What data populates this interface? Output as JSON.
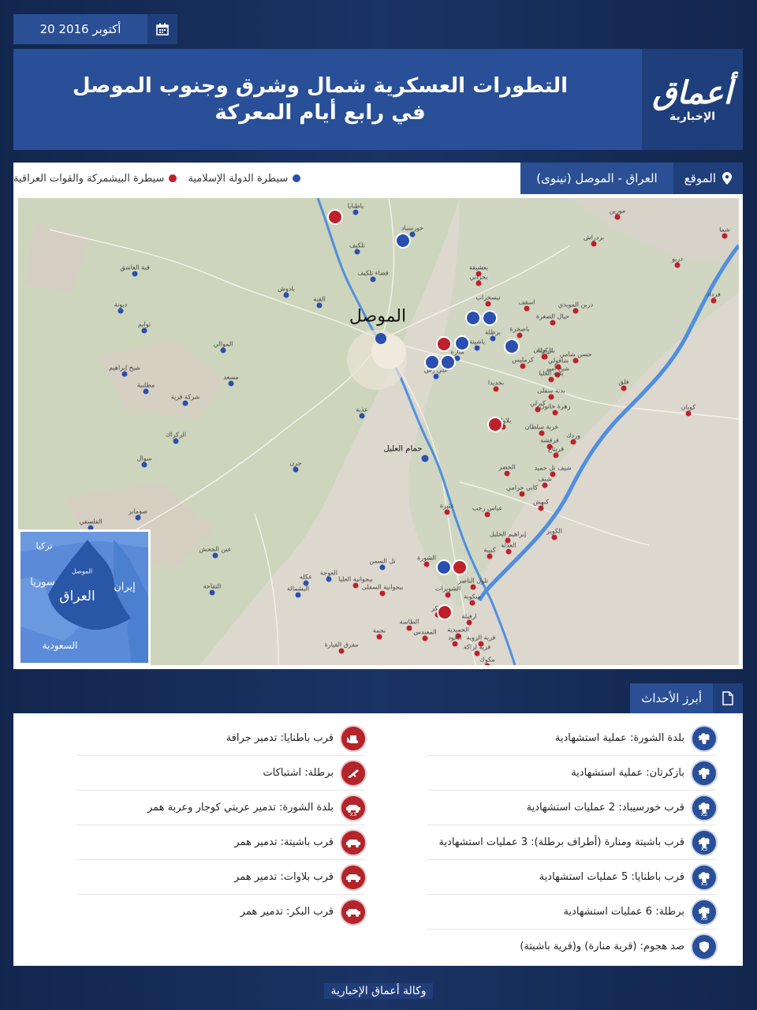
{
  "date": {
    "text": "20 أكتوبر 2016"
  },
  "logo": {
    "main": "أعماق",
    "sub": "الإخبارية"
  },
  "title": {
    "line1": "التطورات العسكرية شمال وشرق وجنوب الموصل",
    "line2": "في رابع أيام المعركة"
  },
  "location": {
    "label": "الموقع",
    "value": "العراق - الموصل (نينوى)"
  },
  "legend": {
    "islamic_state": "سيطرة الدولة الإسلامية",
    "peshmerga_iraqi": "سيطرة البيشمركة والقوات العراقية",
    "colors": {
      "islamic_state": "#2a4fb0",
      "peshmerga_iraqi": "#c0202a"
    }
  },
  "map": {
    "cities": {
      "mosul": "الموصل",
      "hammam": "حمام العليل"
    },
    "places_blue": [
      {
        "name": "باطنايا"
      },
      {
        "name": "خورسباد"
      },
      {
        "name": "تلكيف"
      },
      {
        "name": "قضاء تلكيف"
      },
      {
        "name": "بادوش"
      },
      {
        "name": "القبة"
      },
      {
        "name": "برطلة"
      },
      {
        "name": "باشيتة"
      },
      {
        "name": "منارة"
      },
      {
        "name": "علي رش"
      },
      {
        "name": "الموالي"
      },
      {
        "name": "مسعد"
      },
      {
        "name": "شركة قرية"
      },
      {
        "name": "عذبة"
      },
      {
        "name": "الركراك"
      },
      {
        "name": "سوال"
      },
      {
        "name": "جرن"
      },
      {
        "name": "صومايز"
      },
      {
        "name": "الفلسفي"
      },
      {
        "name": "عين الجحش"
      },
      {
        "name": "تل السمن"
      },
      {
        "name": "العوجة"
      },
      {
        "name": "عكله"
      },
      {
        "name": "التفاحة"
      },
      {
        "name": "البشمالة"
      },
      {
        "name": "قبة العاشق"
      },
      {
        "name": "ديونة"
      },
      {
        "name": "توايم"
      },
      {
        "name": "شيخ إبراهيم"
      },
      {
        "name": "مطلبية"
      }
    ],
    "places_red": [
      {
        "name": "موزين"
      },
      {
        "name": "بردراش"
      },
      {
        "name": "شما"
      },
      {
        "name": "دربو"
      },
      {
        "name": "فرداد"
      },
      {
        "name": "تيسخراب"
      },
      {
        "name": "بعشيقة"
      },
      {
        "name": "بحزاني"
      },
      {
        "name": "اسقف"
      },
      {
        "name": "دربن الموبدي"
      },
      {
        "name": "حيال الصغرة"
      },
      {
        "name": "باصخرة"
      },
      {
        "name": "بازكرتان"
      },
      {
        "name": "تارجلة"
      },
      {
        "name": "حسن شامي"
      },
      {
        "name": "شاقولي"
      },
      {
        "name": "شيخ أمير"
      },
      {
        "name": "كرمليس"
      },
      {
        "name": "بدنة العليا"
      },
      {
        "name": "بدنة سفلى"
      },
      {
        "name": "فلق"
      },
      {
        "name": "زهرة خاتون"
      },
      {
        "name": "كوبان"
      },
      {
        "name": "كبرلي"
      },
      {
        "name": "بخديدا"
      },
      {
        "name": "خربة سلطان"
      },
      {
        "name": "وردك"
      },
      {
        "name": "قرقشة"
      },
      {
        "name": "قريتاغ"
      },
      {
        "name": "بلاوات"
      },
      {
        "name": "شيف تل حميد"
      },
      {
        "name": "شنف"
      },
      {
        "name": "الخضر"
      },
      {
        "name": "كانى حرامي"
      },
      {
        "name": "عباس رجب"
      },
      {
        "name": "كنهش"
      },
      {
        "name": "الكوير"
      },
      {
        "name": "إبراهيم الخليل"
      },
      {
        "name": "العدلة"
      },
      {
        "name": "كبيبة"
      },
      {
        "name": "الشورة"
      },
      {
        "name": "تلول الناصر"
      },
      {
        "name": "منكوبة"
      },
      {
        "name": "البكر"
      },
      {
        "name": "الشويرات"
      },
      {
        "name": "ارفيلة"
      },
      {
        "name": "الحميدية"
      },
      {
        "name": "قرية الزوية"
      },
      {
        "name": "الحود"
      },
      {
        "name": "قرية لزاكة"
      },
      {
        "name": "المعندس"
      },
      {
        "name": "الطاسة"
      },
      {
        "name": "نجمة"
      },
      {
        "name": "مفرق القيارة"
      },
      {
        "name": "مكوك"
      },
      {
        "name": "بيجوانية العليا"
      },
      {
        "name": "بيجوانية السفلى"
      },
      {
        "name": "عثيرة"
      }
    ],
    "inset": {
      "turkey": "تركيا",
      "syria": "سوريا",
      "iraq": "العراق",
      "iran": "إيران",
      "saudi": "السعودية",
      "mosul": "الموصل"
    }
  },
  "events": {
    "heading": "أبرز الأحداث",
    "right": [
      {
        "text": "بلدة الشورة: عملية استشهادية",
        "icon": "explosion-icon",
        "mult": ""
      },
      {
        "text": "بازكرتان: عملية استشهادية",
        "icon": "explosion-icon",
        "mult": ""
      },
      {
        "text": "قرب خورسيباد: 2 عمليات استشهادية",
        "icon": "explosion-icon",
        "mult": "x2"
      },
      {
        "text": "قرب باشيتة ومنارة (أطراف برطلة): 3 عمليات استشهادية",
        "icon": "explosion-icon",
        "mult": "x3"
      },
      {
        "text": "قرب باطنايا: 5 عمليات استشهادية",
        "icon": "explosion-icon",
        "mult": "x5"
      },
      {
        "text": "برطلة: 6 عمليات استشهادية",
        "icon": "explosion-icon",
        "mult": "x6"
      },
      {
        "text": "صد هجوم: (قرية منارة) و(قرية باشيتة)",
        "icon": "shield-icon",
        "mult": ""
      }
    ],
    "left": [
      {
        "text": "قرب باطنايا: تدمير جرافة",
        "icon": "bulldozer-icon",
        "mult": ""
      },
      {
        "text": "برطلة: اشتباكات",
        "icon": "rifle-icon",
        "mult": ""
      },
      {
        "text": "بلدة الشورة: تدمير عربتي كوجار وعربة همر",
        "icon": "vehicle-icon",
        "mult": "x3"
      },
      {
        "text": "قرب باشيتة: تدمير همر",
        "icon": "vehicle-icon",
        "mult": ""
      },
      {
        "text": "قرب بلاوات: تدمير همر",
        "icon": "vehicle-icon",
        "mult": ""
      },
      {
        "text": "قرب البكر: تدمير همر",
        "icon": "vehicle-icon",
        "mult": ""
      }
    ]
  },
  "footer": "وكالة أعماق الإخبارية"
}
